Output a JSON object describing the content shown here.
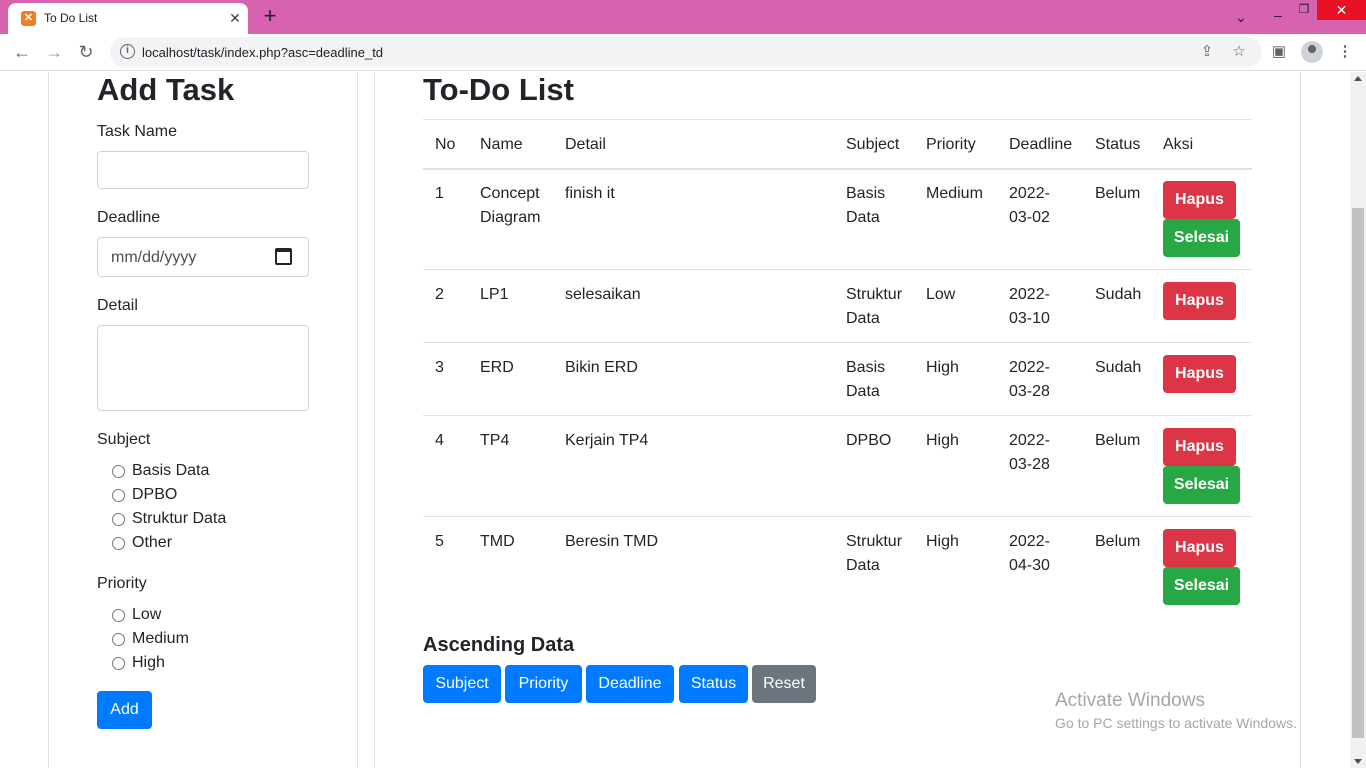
{
  "browser": {
    "tab_title": "To Do List",
    "url": "localhost/task/index.php?asc=deadline_td"
  },
  "form": {
    "title": "Add Task",
    "task_name_label": "Task Name",
    "deadline_label": "Deadline",
    "deadline_placeholder": "mm/dd/yyyy",
    "detail_label": "Detail",
    "subject_label": "Subject",
    "subjects": [
      "Basis Data",
      "DPBO",
      "Struktur Data",
      "Other"
    ],
    "priority_label": "Priority",
    "priorities": [
      "Low",
      "Medium",
      "High"
    ],
    "add_button": "Add"
  },
  "list": {
    "title": "To-Do List",
    "headers": [
      "No",
      "Name",
      "Detail",
      "Subject",
      "Priority",
      "Deadline",
      "Status",
      "Aksi"
    ],
    "rows": [
      {
        "no": "1",
        "name": [
          "Concept",
          "Diagram"
        ],
        "detail": "finish it",
        "subject": [
          "Basis",
          "Data"
        ],
        "priority": "Medium",
        "deadline": [
          "2022-",
          "03-02"
        ],
        "status": "Belum",
        "hapus": "Hapus",
        "selesai": "Selesai"
      },
      {
        "no": "2",
        "name": [
          "LP1"
        ],
        "detail": "selesaikan",
        "subject": [
          "Struktur",
          "Data"
        ],
        "priority": "Low",
        "deadline": [
          "2022-",
          "03-10"
        ],
        "status": "Sudah",
        "hapus": "Hapus",
        "selesai": null
      },
      {
        "no": "3",
        "name": [
          "ERD"
        ],
        "detail": "Bikin ERD",
        "subject": [
          "Basis",
          "Data"
        ],
        "priority": "High",
        "deadline": [
          "2022-",
          "03-28"
        ],
        "status": "Sudah",
        "hapus": "Hapus",
        "selesai": null
      },
      {
        "no": "4",
        "name": [
          "TP4"
        ],
        "detail": "Kerjain TP4",
        "subject": [
          "DPBO"
        ],
        "priority": "High",
        "deadline": [
          "2022-",
          "03-28"
        ],
        "status": "Belum",
        "hapus": "Hapus",
        "selesai": "Selesai"
      },
      {
        "no": "5",
        "name": [
          "TMD"
        ],
        "detail": "Beresin TMD",
        "subject": [
          "Struktur",
          "Data"
        ],
        "priority": "High",
        "deadline": [
          "2022-",
          "04-30"
        ],
        "status": "Belum",
        "hapus": "Hapus",
        "selesai": "Selesai"
      }
    ]
  },
  "ascending": {
    "title": "Ascending Data",
    "buttons": [
      "Subject",
      "Priority",
      "Deadline",
      "Status",
      "Reset"
    ]
  },
  "watermark": {
    "line1": "Activate Windows",
    "line2": "Go to PC settings to activate Windows."
  },
  "colors": {
    "titlebar": "#d662b0",
    "primary": "#007bff",
    "danger": "#dc3545",
    "success": "#28a745",
    "secondary": "#6c757d"
  }
}
